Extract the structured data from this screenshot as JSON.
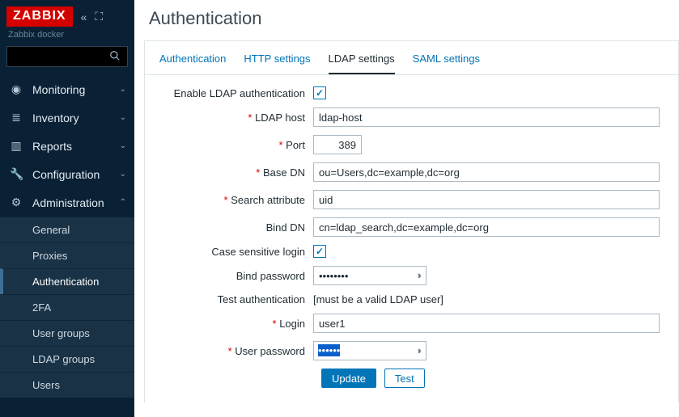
{
  "brand": {
    "logo": "ZABBIX",
    "subtitle": "Zabbix docker"
  },
  "sidebar": {
    "icons": {
      "collapse": "«",
      "fullscreen": "⛶"
    },
    "search_placeholder": "",
    "nav": [
      {
        "icon": "◉",
        "label": "Monitoring",
        "chev": "⌄"
      },
      {
        "icon": "≣",
        "label": "Inventory",
        "chev": "⌄"
      },
      {
        "icon": "▥",
        "label": "Reports",
        "chev": "⌄"
      },
      {
        "icon": "🔧",
        "label": "Configuration",
        "chev": "⌄"
      },
      {
        "icon": "⚙",
        "label": "Administration",
        "chev": "⌃"
      }
    ],
    "subnav": [
      "General",
      "Proxies",
      "Authentication",
      "2FA",
      "User groups",
      "LDAP groups",
      "Users"
    ],
    "subnav_active": 2
  },
  "page": {
    "title": "Authentication"
  },
  "tabs": {
    "items": [
      "Authentication",
      "HTTP settings",
      "LDAP settings",
      "SAML settings"
    ],
    "active": 2
  },
  "form": {
    "enable_ldap_label": "Enable LDAP authentication",
    "enable_ldap_checked": true,
    "ldap_host_label": "LDAP host",
    "ldap_host_value": "ldap-host",
    "port_label": "Port",
    "port_value": "389",
    "base_dn_label": "Base DN",
    "base_dn_value": "ou=Users,dc=example,dc=org",
    "search_attr_label": "Search attribute",
    "search_attr_value": "uid",
    "bind_dn_label": "Bind DN",
    "bind_dn_value": "cn=ldap_search,dc=example,dc=org",
    "case_sensitive_label": "Case sensitive login",
    "case_sensitive_checked": true,
    "bind_password_label": "Bind password",
    "bind_password_value": "••••••••",
    "test_auth_label": "Test authentication",
    "test_auth_hint": "[must be a valid LDAP user]",
    "login_label": "Login",
    "login_value": "user1",
    "user_password_label": "User password",
    "user_password_value": "••••••",
    "update_btn": "Update",
    "test_btn": "Test"
  }
}
